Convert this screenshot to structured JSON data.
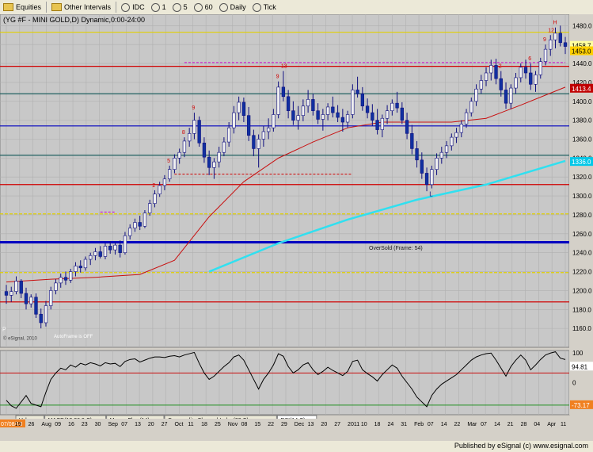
{
  "toolbar": {
    "items": [
      {
        "label": "Equities",
        "icon": "folder-icon"
      },
      {
        "label": "Other Intervals",
        "icon": "folder-icon"
      },
      {
        "label": "IDC",
        "icon": "circle-icon"
      },
      {
        "label": "1"
      },
      {
        "label": "5"
      },
      {
        "label": "60"
      },
      {
        "label": "Daily"
      },
      {
        "label": "Tick"
      }
    ]
  },
  "footer": {
    "text": "Published by eSignal (c) www.esignal.com"
  },
  "chart_data": {
    "type": "candlestick",
    "title": "(YG #F - MINI GOLD,D) Dynamic,0:00-24:00",
    "price_axis": {
      "ticks": [
        1160,
        1180,
        1200,
        1220,
        1240,
        1260,
        1280,
        1300,
        1320,
        1340,
        1360,
        1380,
        1400,
        1420,
        1440,
        1460,
        1480
      ],
      "tick_labels": [
        "1160.0",
        "1180.0",
        "1200.0",
        "1220.0",
        "1240.0",
        "1260.0",
        "1280.0",
        "1300.0",
        "1320.0",
        "1340.0",
        "1360.0",
        "1380.0",
        "1400.0",
        "1420.0",
        "1440.0",
        "1460.0",
        "1480.0"
      ],
      "ylim": [
        1140,
        1492
      ]
    },
    "price_tags": [
      {
        "label": "1458.7",
        "color": "#ffffa0",
        "text_color": "#000000"
      },
      {
        "label": "1453.0",
        "color": "#ffd000",
        "text_color": "#000000"
      },
      {
        "label": "1413.4",
        "color": "#c00000",
        "text_color": "#ffffff"
      },
      {
        "label": "1336.0",
        "color": "#00c8e8",
        "text_color": "#ffffff"
      }
    ],
    "date_labels": [
      "07/08/10",
      "19",
      "26",
      "Aug",
      "09",
      "16",
      "23",
      "30",
      "Sep",
      "07",
      "13",
      "20",
      "27",
      "Oct",
      "11",
      "18",
      "25",
      "Nov",
      "08",
      "15",
      "22",
      "29",
      "Dec",
      "13",
      "20",
      "27",
      "2011",
      "10",
      "18",
      "24",
      "31",
      "Feb",
      "07",
      "14",
      "22",
      "Mar",
      "07",
      "14",
      "21",
      "28",
      "04",
      "Apr",
      "11"
    ],
    "horizontal_levels": [
      {
        "value": 1473,
        "color": "#e0d000",
        "style": "solid"
      },
      {
        "value": 1437,
        "color": "#d00000",
        "style": "solid"
      },
      {
        "value": 1408,
        "color": "#206060",
        "style": "solid"
      },
      {
        "value": 1374,
        "color": "#0000c0",
        "style": "solid"
      },
      {
        "value": 1343,
        "color": "#206060",
        "style": "solid"
      },
      {
        "value": 1312,
        "color": "#d00000",
        "style": "solid"
      },
      {
        "value": 1281,
        "color": "#e0d000",
        "style": "dashed"
      },
      {
        "value": 1251,
        "color": "#0000c0",
        "style": "solid-thick"
      },
      {
        "value": 1219,
        "color": "#e0d000",
        "style": "dashed"
      },
      {
        "value": 1188,
        "color": "#d00000",
        "style": "solid"
      }
    ],
    "annotations": [
      {
        "text": "OverSold (Frame: 54)"
      },
      {
        "text": "AutoFrame is OFF"
      },
      {
        "text": "© eSignal, 2010"
      }
    ],
    "setup_markers": [
      "9",
      "8",
      "7",
      "6",
      "5",
      "4",
      "3",
      "2",
      "1",
      "12",
      "11",
      "10",
      "13",
      "H",
      "L",
      "P"
    ],
    "candles": [
      [
        1199,
        1206,
        1186,
        1195
      ],
      [
        1195,
        1204,
        1188,
        1199
      ],
      [
        1199,
        1215,
        1196,
        1210
      ],
      [
        1210,
        1212,
        1192,
        1197
      ],
      [
        1197,
        1203,
        1180,
        1186
      ],
      [
        1186,
        1196,
        1182,
        1193
      ],
      [
        1193,
        1197,
        1171,
        1175
      ],
      [
        1175,
        1181,
        1160,
        1166
      ],
      [
        1166,
        1189,
        1162,
        1184
      ],
      [
        1184,
        1204,
        1180,
        1200
      ],
      [
        1200,
        1212,
        1196,
        1208
      ],
      [
        1208,
        1218,
        1203,
        1214
      ],
      [
        1214,
        1220,
        1206,
        1211
      ],
      [
        1211,
        1223,
        1208,
        1220
      ],
      [
        1220,
        1230,
        1215,
        1226
      ],
      [
        1226,
        1232,
        1219,
        1224
      ],
      [
        1224,
        1236,
        1221,
        1233
      ],
      [
        1233,
        1240,
        1227,
        1237
      ],
      [
        1237,
        1245,
        1232,
        1241
      ],
      [
        1241,
        1247,
        1234,
        1236
      ],
      [
        1236,
        1250,
        1233,
        1247
      ],
      [
        1247,
        1252,
        1239,
        1243
      ],
      [
        1243,
        1251,
        1238,
        1248
      ],
      [
        1248,
        1253,
        1235,
        1240
      ],
      [
        1240,
        1262,
        1238,
        1258
      ],
      [
        1258,
        1270,
        1254,
        1266
      ],
      [
        1266,
        1276,
        1262,
        1272
      ],
      [
        1272,
        1279,
        1264,
        1268
      ],
      [
        1268,
        1285,
        1266,
        1282
      ],
      [
        1282,
        1296,
        1279,
        1292
      ],
      [
        1292,
        1306,
        1288,
        1302
      ],
      [
        1302,
        1315,
        1299,
        1311
      ],
      [
        1311,
        1322,
        1306,
        1318
      ],
      [
        1318,
        1332,
        1315,
        1328
      ],
      [
        1328,
        1344,
        1324,
        1340
      ],
      [
        1340,
        1350,
        1334,
        1346
      ],
      [
        1346,
        1362,
        1341,
        1358
      ],
      [
        1358,
        1372,
        1352,
        1366
      ],
      [
        1366,
        1388,
        1360,
        1380
      ],
      [
        1380,
        1384,
        1352,
        1356
      ],
      [
        1356,
        1362,
        1335,
        1341
      ],
      [
        1341,
        1348,
        1322,
        1330
      ],
      [
        1330,
        1340,
        1318,
        1336
      ],
      [
        1336,
        1352,
        1330,
        1346
      ],
      [
        1346,
        1362,
        1342,
        1357
      ],
      [
        1357,
        1378,
        1352,
        1372
      ],
      [
        1372,
        1395,
        1366,
        1388
      ],
      [
        1388,
        1405,
        1380,
        1399
      ],
      [
        1399,
        1404,
        1378,
        1385
      ],
      [
        1385,
        1394,
        1358,
        1364
      ],
      [
        1364,
        1370,
        1342,
        1350
      ],
      [
        1350,
        1365,
        1330,
        1360
      ],
      [
        1360,
        1374,
        1352,
        1368
      ],
      [
        1368,
        1382,
        1360,
        1372
      ],
      [
        1372,
        1392,
        1368,
        1386
      ],
      [
        1386,
        1421,
        1382,
        1415
      ],
      [
        1415,
        1432,
        1400,
        1405
      ],
      [
        1405,
        1412,
        1382,
        1390
      ],
      [
        1390,
        1400,
        1375,
        1380
      ],
      [
        1380,
        1395,
        1370,
        1385
      ],
      [
        1385,
        1402,
        1379,
        1395
      ],
      [
        1395,
        1412,
        1388,
        1402
      ],
      [
        1402,
        1408,
        1385,
        1390
      ],
      [
        1390,
        1398,
        1376,
        1381
      ],
      [
        1381,
        1392,
        1369,
        1386
      ],
      [
        1386,
        1398,
        1380,
        1394
      ],
      [
        1394,
        1405,
        1383,
        1388
      ],
      [
        1388,
        1396,
        1378,
        1383
      ],
      [
        1383,
        1392,
        1368,
        1378
      ],
      [
        1378,
        1390,
        1372,
        1386
      ],
      [
        1386,
        1418,
        1382,
        1412
      ],
      [
        1412,
        1426,
        1404,
        1408
      ],
      [
        1408,
        1415,
        1390,
        1395
      ],
      [
        1395,
        1403,
        1382,
        1388
      ],
      [
        1388,
        1397,
        1374,
        1380
      ],
      [
        1380,
        1392,
        1365,
        1370
      ],
      [
        1370,
        1386,
        1362,
        1382
      ],
      [
        1382,
        1396,
        1376,
        1390
      ],
      [
        1390,
        1402,
        1385,
        1398
      ],
      [
        1398,
        1410,
        1388,
        1393
      ],
      [
        1393,
        1399,
        1376,
        1380
      ],
      [
        1380,
        1388,
        1360,
        1366
      ],
      [
        1366,
        1375,
        1344,
        1350
      ],
      [
        1350,
        1358,
        1330,
        1338
      ],
      [
        1338,
        1346,
        1318,
        1324
      ],
      [
        1324,
        1330,
        1305,
        1312
      ],
      [
        1312,
        1332,
        1308,
        1328
      ],
      [
        1328,
        1345,
        1322,
        1340
      ],
      [
        1340,
        1352,
        1334,
        1346
      ],
      [
        1346,
        1358,
        1340,
        1353
      ],
      [
        1353,
        1366,
        1348,
        1362
      ],
      [
        1362,
        1372,
        1356,
        1367
      ],
      [
        1367,
        1380,
        1362,
        1376
      ],
      [
        1376,
        1392,
        1372,
        1388
      ],
      [
        1388,
        1404,
        1384,
        1400
      ],
      [
        1400,
        1418,
        1395,
        1413
      ],
      [
        1413,
        1428,
        1408,
        1422
      ],
      [
        1422,
        1436,
        1416,
        1430
      ],
      [
        1430,
        1444,
        1422,
        1438
      ],
      [
        1438,
        1445,
        1418,
        1424
      ],
      [
        1424,
        1432,
        1405,
        1412
      ],
      [
        1412,
        1420,
        1392,
        1398
      ],
      [
        1398,
        1418,
        1392,
        1414
      ],
      [
        1414,
        1430,
        1408,
        1425
      ],
      [
        1425,
        1440,
        1420,
        1436
      ],
      [
        1436,
        1444,
        1424,
        1430
      ],
      [
        1430,
        1440,
        1412,
        1418
      ],
      [
        1418,
        1432,
        1410,
        1428
      ],
      [
        1428,
        1446,
        1424,
        1442
      ],
      [
        1442,
        1460,
        1438,
        1455
      ],
      [
        1455,
        1470,
        1448,
        1465
      ],
      [
        1465,
        1478,
        1456,
        1472
      ],
      [
        1472,
        1480,
        1458,
        1462
      ],
      [
        1462,
        1468,
        1450,
        1458
      ]
    ],
    "moving_average_red": [
      [
        0,
        1209
      ],
      [
        9,
        1212
      ],
      [
        18,
        1214
      ],
      [
        27,
        1217
      ],
      [
        34,
        1232
      ],
      [
        41,
        1278
      ],
      [
        48,
        1315
      ],
      [
        55,
        1340
      ],
      [
        62,
        1357
      ],
      [
        69,
        1372
      ],
      [
        76,
        1378
      ],
      [
        83,
        1378
      ],
      [
        90,
        1378
      ],
      [
        97,
        1382
      ],
      [
        104,
        1396
      ],
      [
        113,
        1415
      ]
    ],
    "moving_average_cyan": [
      [
        41,
        1220
      ],
      [
        55,
        1250
      ],
      [
        69,
        1275
      ],
      [
        83,
        1296
      ],
      [
        97,
        1312
      ],
      [
        113,
        1337
      ]
    ],
    "dashed_lines": [
      {
        "y": 1441,
        "x0": 36,
        "x1": 113,
        "color": "#d000d0"
      },
      {
        "y": 1323,
        "x0": 34,
        "x1": 70,
        "color": "#d00000"
      },
      {
        "y": 1283,
        "x0": 19,
        "x1": 22,
        "color": "#d000d0"
      }
    ],
    "rsi": {
      "title": "RSI(14,C)",
      "value_label": "94.81",
      "lower_label": "-73.17",
      "ticks": [
        "100",
        "0"
      ],
      "series": [
        -55,
        -72,
        -80,
        -60,
        -40,
        -65,
        -70,
        -75,
        -30,
        10,
        30,
        45,
        40,
        55,
        48,
        60,
        55,
        62,
        58,
        52,
        62,
        58,
        60,
        50,
        66,
        72,
        74,
        64,
        70,
        76,
        80,
        80,
        78,
        82,
        84,
        80,
        86,
        90,
        94,
        60,
        30,
        10,
        20,
        35,
        50,
        62,
        80,
        86,
        70,
        40,
        10,
        -20,
        10,
        30,
        55,
        90,
        82,
        50,
        30,
        40,
        55,
        62,
        40,
        25,
        35,
        48,
        38,
        30,
        22,
        35,
        66,
        70,
        40,
        28,
        18,
        5,
        25,
        40,
        55,
        45,
        20,
        0,
        -20,
        -45,
        -60,
        -75,
        -40,
        -20,
        -5,
        5,
        15,
        25,
        40,
        55,
        70,
        80,
        86,
        90,
        92,
        70,
        45,
        20,
        50,
        70,
        86,
        70,
        40,
        55,
        72,
        86,
        92,
        96,
        76,
        72
      ]
    },
    "indicator_tabs": [
      "Volume",
      "MACD(12,26,9,C)",
      "Money Flow(14)",
      "Commodity Channel Index(23,C)",
      "RSI(14,C)"
    ]
  }
}
